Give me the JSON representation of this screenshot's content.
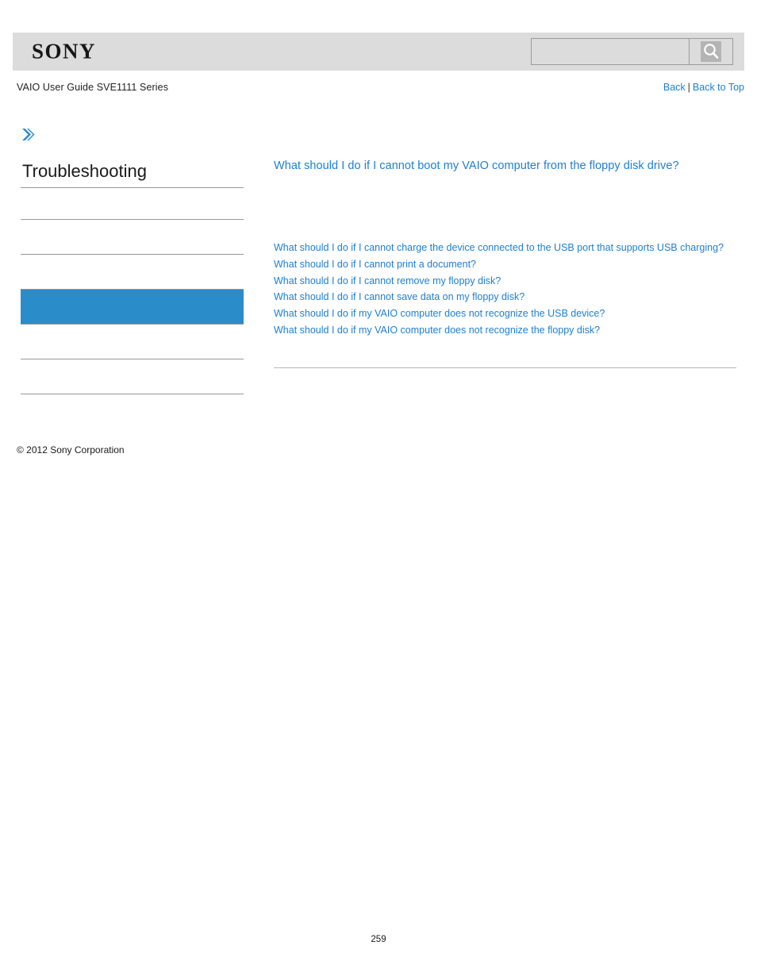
{
  "header": {
    "logo_text": "SONY",
    "search": {
      "value": "",
      "placeholder": "",
      "icon": "search-icon"
    }
  },
  "subheader": {
    "document_title": "VAIO User Guide SVE1111 Series",
    "back_label": "Back",
    "separator": "|",
    "back_to_top_label": "Back to Top"
  },
  "sidebar": {
    "chevron_icon": "double-chevron-right-icon",
    "title": "Troubleshooting",
    "accent_color": "#2b8cca",
    "items": [
      {
        "label": "",
        "active": false
      },
      {
        "label": "",
        "active": false
      },
      {
        "label": "",
        "active": false
      },
      {
        "label": "",
        "active": true
      },
      {
        "label": "",
        "active": false
      },
      {
        "label": "",
        "active": false
      }
    ]
  },
  "main": {
    "heading": "What should I do if I cannot boot my VAIO computer from the floppy disk drive?",
    "related_links": [
      "What should I do if I cannot charge the device connected to the USB port that supports USB charging?",
      "What should I do if I cannot print a document?",
      "What should I do if I cannot remove my floppy disk?",
      "What should I do if I cannot save data on my floppy disk?",
      "What should I do if my VAIO computer does not recognize the USB device?",
      "What should I do if my VAIO computer does not recognize the floppy disk?"
    ],
    "link_color": "#1e7fd0"
  },
  "footer": {
    "copyright": "© 2012 Sony Corporation",
    "page_number": "259"
  }
}
